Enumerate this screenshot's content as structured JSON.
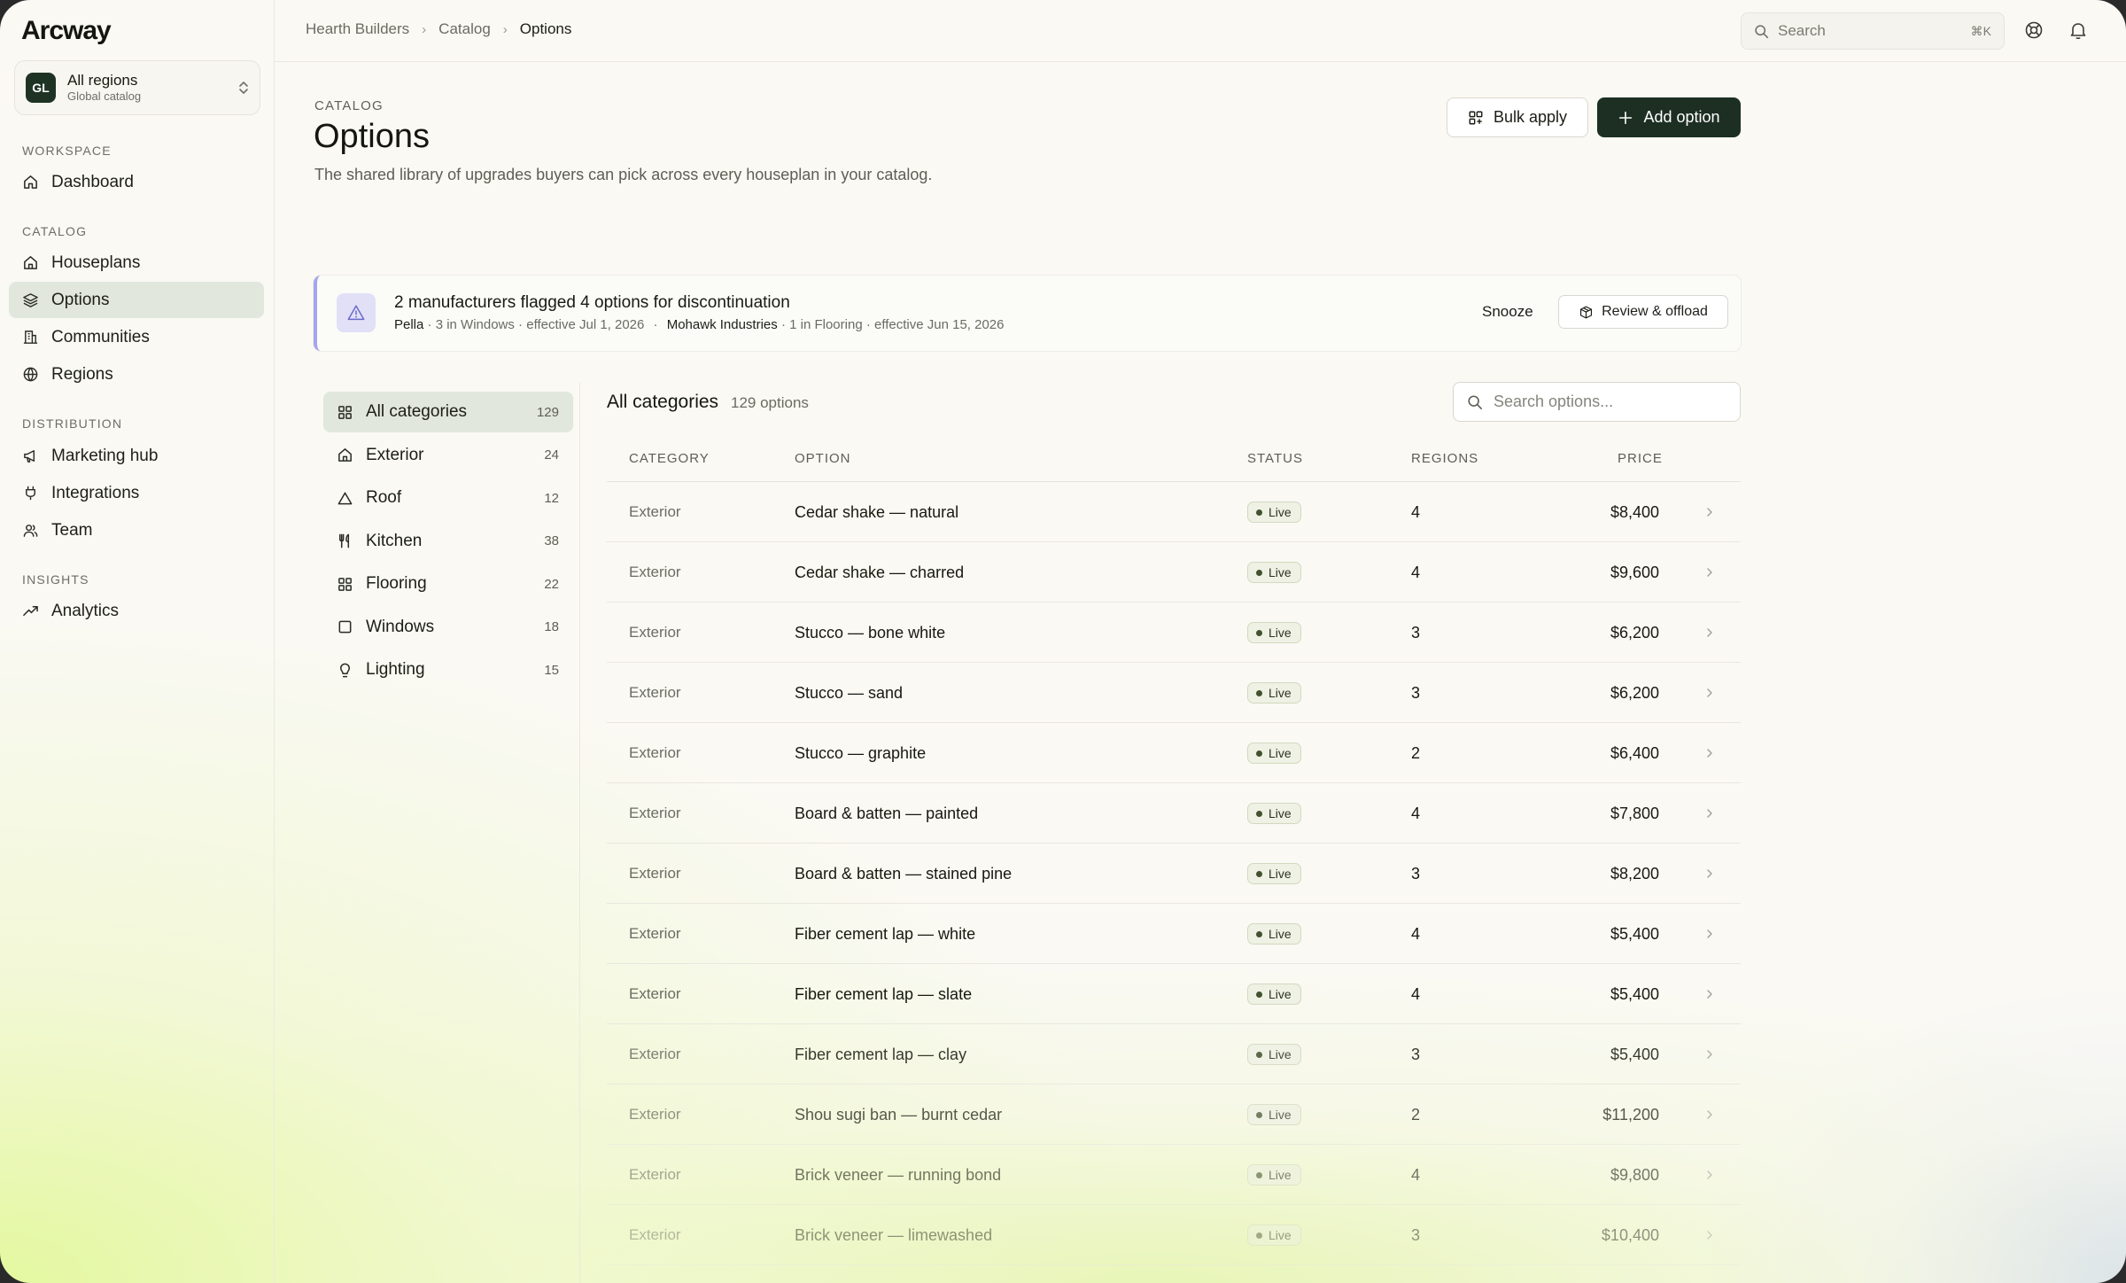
{
  "app": {
    "logo": "Arcway"
  },
  "region_switcher": {
    "avatar": "GL",
    "title": "All regions",
    "subtitle": "Global catalog"
  },
  "sidebar": {
    "sections": [
      {
        "heading": "Workspace",
        "items": [
          {
            "label": "Dashboard",
            "icon": "home-icon"
          }
        ]
      },
      {
        "heading": "Catalog",
        "items": [
          {
            "label": "Houseplans",
            "icon": "house-icon"
          },
          {
            "label": "Options",
            "icon": "layers-icon",
            "active": true
          },
          {
            "label": "Communities",
            "icon": "building-icon"
          },
          {
            "label": "Regions",
            "icon": "globe-icon"
          }
        ]
      },
      {
        "heading": "Distribution",
        "items": [
          {
            "label": "Marketing hub",
            "icon": "megaphone-icon"
          },
          {
            "label": "Integrations",
            "icon": "plug-icon"
          },
          {
            "label": "Team",
            "icon": "users-icon"
          }
        ]
      },
      {
        "heading": "Insights",
        "items": [
          {
            "label": "Analytics",
            "icon": "trend-icon"
          }
        ]
      }
    ]
  },
  "topbar": {
    "breadcrumb": [
      "Hearth Builders",
      "Catalog",
      "Options"
    ],
    "search_placeholder": "Search",
    "search_shortcut": "⌘K"
  },
  "header": {
    "eyebrow": "Catalog",
    "title": "Options",
    "description": "The shared library of upgrades buyers can pick across every houseplan in your catalog.",
    "bulk_apply_label": "Bulk apply",
    "add_option_label": "Add option"
  },
  "alert": {
    "title": "2 manufacturers flagged 4 options for discontinuation",
    "items": [
      {
        "manufacturer": "Pella",
        "detail": " · 3 in Windows · effective Jul 1, 2026"
      },
      {
        "manufacturer": "Mohawk Industries",
        "detail": " · 1 in Flooring · effective Jun 15, 2026"
      }
    ],
    "separator": "·",
    "snooze_label": "Snooze",
    "review_label": "Review & offload"
  },
  "categories": [
    {
      "label": "All categories",
      "count": "129",
      "icon": "grid-icon",
      "active": true
    },
    {
      "label": "Exterior",
      "count": "24",
      "icon": "house-icon"
    },
    {
      "label": "Roof",
      "count": "12",
      "icon": "triangle-icon"
    },
    {
      "label": "Kitchen",
      "count": "38",
      "icon": "utensils-icon"
    },
    {
      "label": "Flooring",
      "count": "22",
      "icon": "grid-icon"
    },
    {
      "label": "Windows",
      "count": "18",
      "icon": "square-icon"
    },
    {
      "label": "Lighting",
      "count": "15",
      "icon": "bulb-icon"
    }
  ],
  "table": {
    "title": "All categories",
    "count_label": "129 options",
    "search_placeholder": "Search options...",
    "columns": {
      "category": "Category",
      "option": "Option",
      "status": "Status",
      "regions": "Regions",
      "price": "Price"
    },
    "rows": [
      {
        "category": "Exterior",
        "option": "Cedar shake — natural",
        "status": "Live",
        "regions": "4",
        "price": "$8,400"
      },
      {
        "category": "Exterior",
        "option": "Cedar shake — charred",
        "status": "Live",
        "regions": "4",
        "price": "$9,600"
      },
      {
        "category": "Exterior",
        "option": "Stucco — bone white",
        "status": "Live",
        "regions": "3",
        "price": "$6,200"
      },
      {
        "category": "Exterior",
        "option": "Stucco — sand",
        "status": "Live",
        "regions": "3",
        "price": "$6,200"
      },
      {
        "category": "Exterior",
        "option": "Stucco — graphite",
        "status": "Live",
        "regions": "2",
        "price": "$6,400"
      },
      {
        "category": "Exterior",
        "option": "Board & batten — painted",
        "status": "Live",
        "regions": "4",
        "price": "$7,800"
      },
      {
        "category": "Exterior",
        "option": "Board & batten — stained pine",
        "status": "Live",
        "regions": "3",
        "price": "$8,200"
      },
      {
        "category": "Exterior",
        "option": "Fiber cement lap — white",
        "status": "Live",
        "regions": "4",
        "price": "$5,400"
      },
      {
        "category": "Exterior",
        "option": "Fiber cement lap — slate",
        "status": "Live",
        "regions": "4",
        "price": "$5,400"
      },
      {
        "category": "Exterior",
        "option": "Fiber cement lap — clay",
        "status": "Live",
        "regions": "3",
        "price": "$5,400"
      },
      {
        "category": "Exterior",
        "option": "Shou sugi ban — burnt cedar",
        "status": "Live",
        "regions": "2",
        "price": "$11,200"
      },
      {
        "category": "Exterior",
        "option": "Brick veneer — running bond",
        "status": "Live",
        "regions": "4",
        "price": "$9,800"
      },
      {
        "category": "Exterior",
        "option": "Brick veneer — limewashed",
        "status": "Live",
        "regions": "3",
        "price": "$10,400"
      }
    ]
  },
  "colors": {
    "accent": "#1d2f23",
    "active_bg": "#e2e7dd",
    "alert_accent": "#a6a4ec",
    "live_badge_bg": "#eef1e3"
  }
}
